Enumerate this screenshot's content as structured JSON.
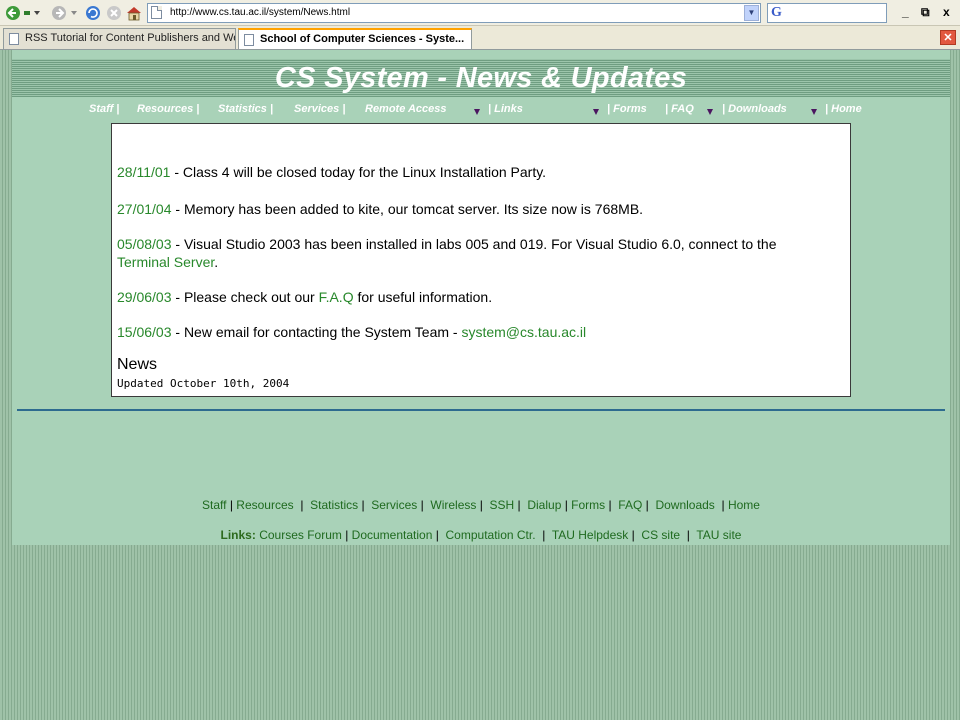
{
  "browser": {
    "url": "http://www.cs.tau.ac.il/system/News.html",
    "tabs": [
      {
        "label": "RSS Tutorial for Content Publishers and We..."
      },
      {
        "label": "School of Computer Sciences - Syste..."
      }
    ],
    "window_buttons": [
      "_",
      "⧉",
      "x"
    ],
    "tab_close": "✕"
  },
  "page": {
    "title": "CS System - News & Updates",
    "top_nav": [
      "Staff |",
      "Resources |",
      "Statistics |",
      "Services |",
      "Remote Access",
      "| Links",
      "| Forms",
      "| FAQ",
      "| Downloads",
      "| Home"
    ],
    "news_items": [
      {
        "date": "28/11/01",
        "text": " - Class 4 will be closed today for the Linux Installation Party."
      },
      {
        "date": "27/01/04",
        "text": " - Memory has been added to kite, our tomcat server. Its size now is 768MB."
      },
      {
        "date": "05/08/03",
        "text": " - Visual Studio 2003 has been installed in labs 005 and 019. For Visual Studio 6.0, connect to the ",
        "link": "Terminal Server",
        "text_after": "."
      },
      {
        "date": "29/06/03",
        "text": " - Please check out our ",
        "link": "F.A.Q",
        "text_after": " for useful information."
      },
      {
        "date": "15/06/03",
        "text": " - New email for contacting the System Team - ",
        "link": "system@cs.tau.ac.il"
      }
    ],
    "news_heading": "News",
    "updated": "Updated October 10th, 2004",
    "bottom_nav": [
      "Staff",
      "Resources",
      "Statistics",
      "Services",
      "Wireless",
      "SSH",
      "Dialup",
      "Forms",
      "FAQ",
      "Downloads",
      "Home"
    ],
    "links_label": "Links:",
    "links": [
      "Courses Forum",
      "Documentation",
      "Computation Ctr.",
      "TAU Helpdesk",
      "CS site",
      "TAU site"
    ]
  },
  "colors": {
    "page_bg": "#a9d2b8",
    "link_green": "#28882b",
    "banner_text": "#ffffff",
    "rule": "#2d6b8f"
  }
}
